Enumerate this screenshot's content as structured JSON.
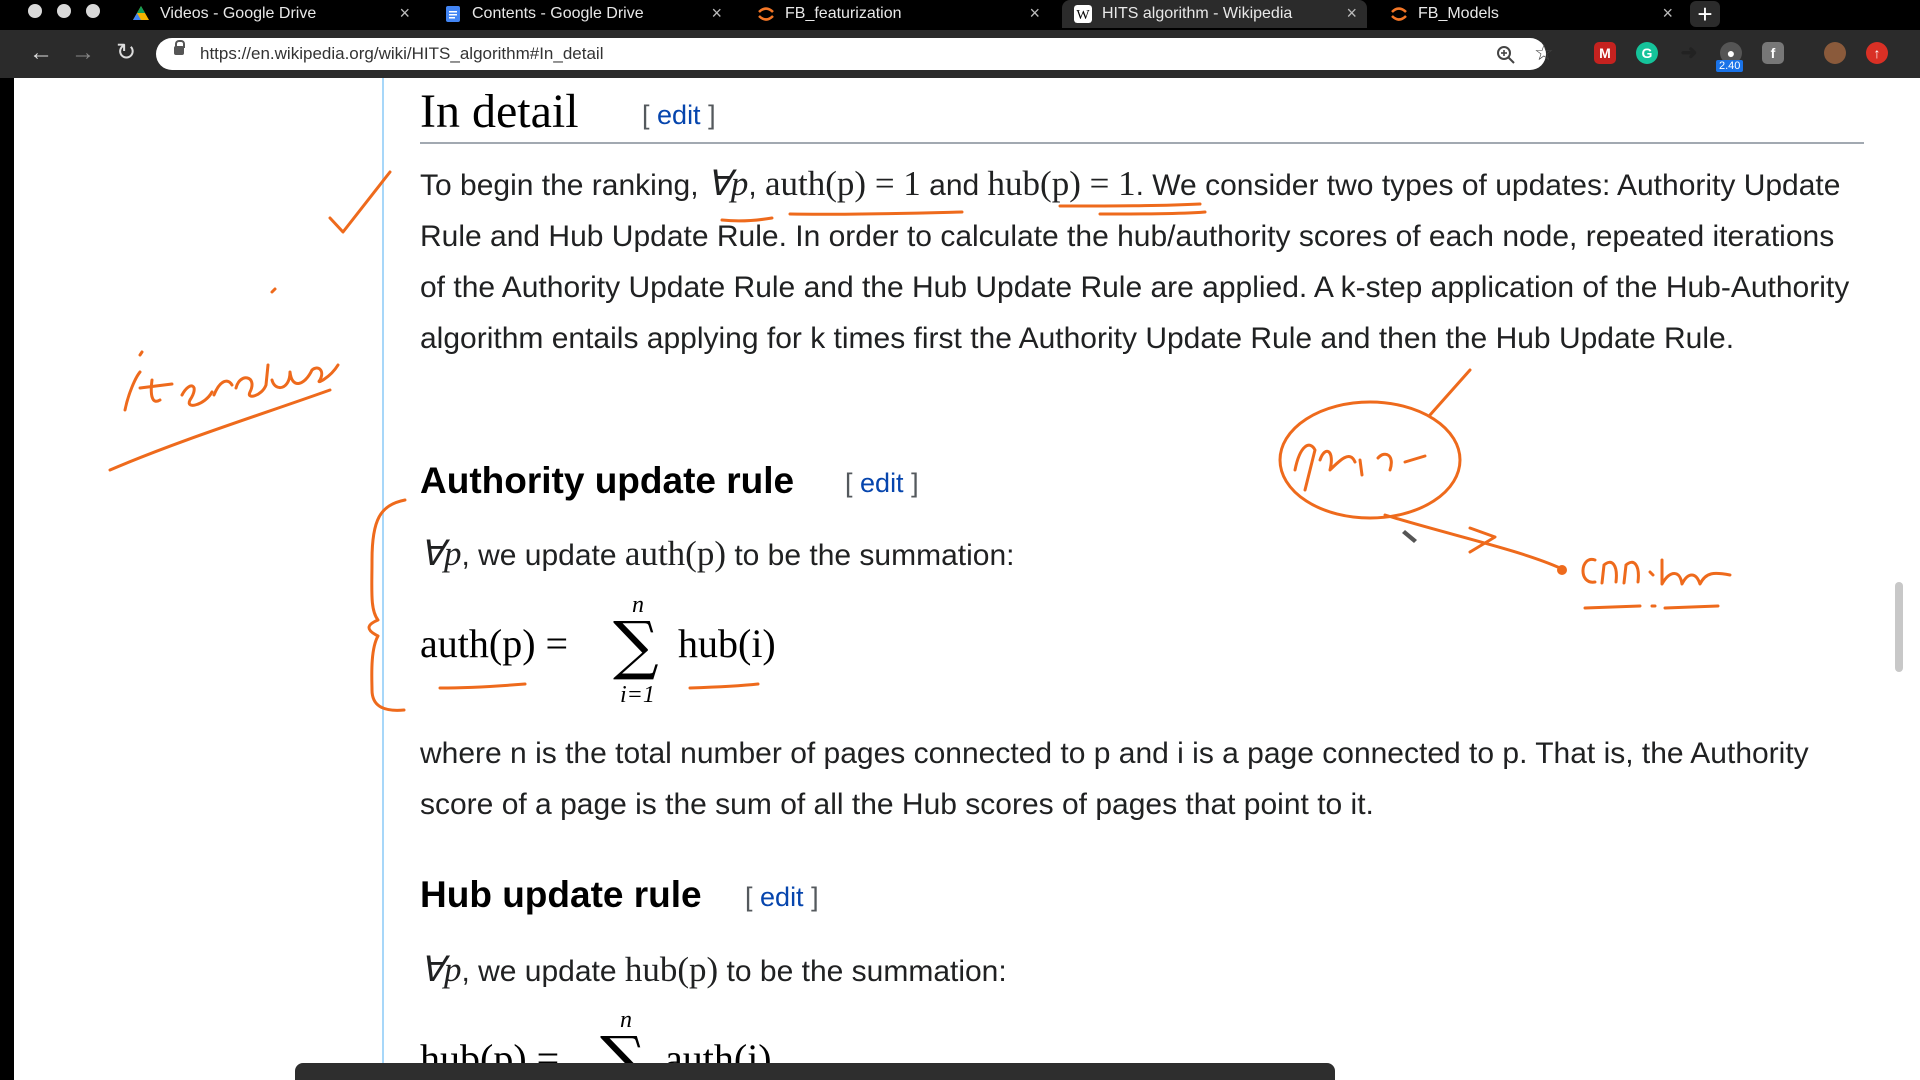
{
  "tabs": [
    {
      "title": "Videos - Google Drive",
      "favicon": "google-drive-icon",
      "color": "#f4b400"
    },
    {
      "title": "Contents - Google Drive",
      "favicon": "google-docs-icon",
      "color": "#4285f4"
    },
    {
      "title": "FB_featurization",
      "favicon": "jupyter-icon",
      "color": "#f37626"
    },
    {
      "title": "HITS algorithm - Wikipedia",
      "favicon": "wikipedia-icon",
      "color": "#ffffff"
    },
    {
      "title": "FB_Models",
      "favicon": "jupyter-icon",
      "color": "#f37626"
    }
  ],
  "active_tab": 3,
  "toolbar": {
    "url": "https://en.wikipedia.org/wiki/HITS_algorithm#In_detail",
    "extension_badge": "2.40"
  },
  "article": {
    "heading": "In detail",
    "edit_open": "[",
    "edit_label": "edit",
    "edit_close": "]",
    "intro": {
      "t1": "To begin the ranking, ",
      "m1": "∀p",
      "t2": ", ",
      "m2": "auth(p) = 1",
      "t3": " and ",
      "m3": "hub(p) = 1",
      "t4": ". We consider two types of updates: Authority Update Rule and Hub Update Rule. In order to calculate the hub/authority scores of each node, repeated iterations of the Authority Update Rule and the Hub Update Rule are applied. A k-step application of the Hub-Authority algorithm entails applying for k times first the Authority Update Rule and then the Hub Update Rule."
    },
    "authority": {
      "heading": "Authority update rule",
      "sentence_m": "∀p",
      "sentence_t1": ", we update ",
      "sentence_m2": "auth(p)",
      "sentence_t2": " to be the summation:",
      "formula_lhs": "auth(p) =",
      "formula_sup": "n",
      "formula_sub": "i=1",
      "formula_rhs": "hub(i)",
      "explanation": "where n is the total number of pages connected to p and i is a page connected to p. That is, the Authority score of a page is the sum of all the Hub scores of pages that point to it."
    },
    "hub": {
      "heading": "Hub update rule",
      "sentence_m": "∀p",
      "sentence_t1": ", we update ",
      "sentence_m2": "hub(p)",
      "sentence_t2": " to be the summation:",
      "formula_lhs": "hub(p) =",
      "formula_sup": "n",
      "formula_rhs": "auth(i)"
    }
  },
  "annotation_color": "#ee6a1c"
}
